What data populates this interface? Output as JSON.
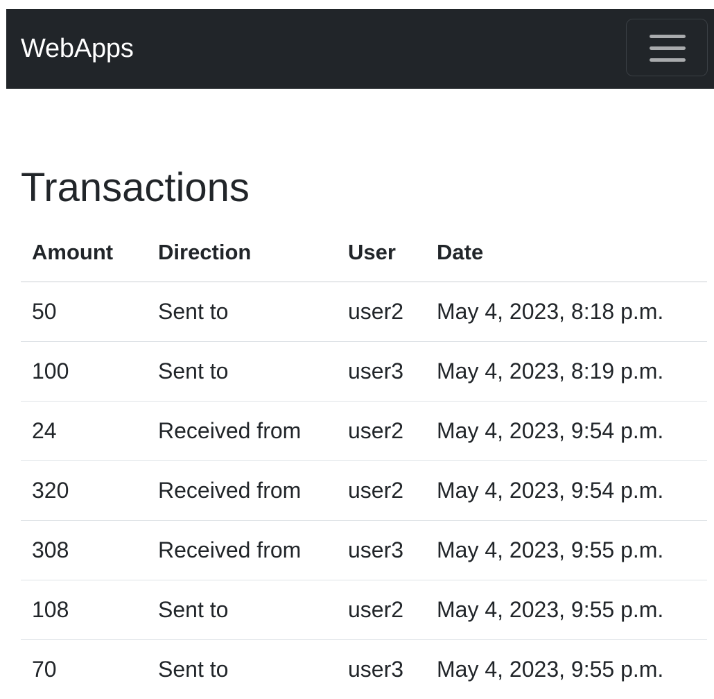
{
  "navbar": {
    "brand": "WebApps",
    "toggler_icon": "hamburger-menu-icon"
  },
  "page": {
    "title": "Transactions"
  },
  "table": {
    "headers": [
      "Amount",
      "Direction",
      "User",
      "Date"
    ],
    "rows": [
      [
        "50",
        "Sent to",
        "user2",
        "May 4, 2023, 8:18 p.m."
      ],
      [
        "100",
        "Sent to",
        "user3",
        "May 4, 2023, 8:19 p.m."
      ],
      [
        "24",
        "Received from",
        "user2",
        "May 4, 2023, 9:54 p.m."
      ],
      [
        "320",
        "Received from",
        "user2",
        "May 4, 2023, 9:54 p.m."
      ],
      [
        "308",
        "Received from",
        "user3",
        "May 4, 2023, 9:55 p.m."
      ],
      [
        "108",
        "Sent to",
        "user2",
        "May 4, 2023, 9:55 p.m."
      ],
      [
        "70",
        "Sent to",
        "user3",
        "May 4, 2023, 9:55 p.m."
      ]
    ]
  },
  "colors": {
    "navbar_bg": "#212529",
    "text": "#212529",
    "row_border": "#dee2e6"
  }
}
